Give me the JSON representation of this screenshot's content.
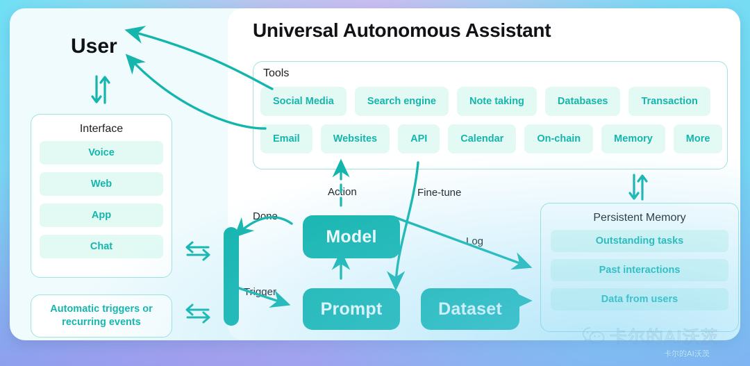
{
  "background": {
    "gradient_from": "#6fe0f5",
    "gradient_mid": "#c9bdf0",
    "gradient_to": "#6fdff5"
  },
  "theme": {
    "accent": "#14b5ad",
    "pill_bg": "#e3faf4",
    "card_bg": "#f0fbfd",
    "panel_bg": "#ffffff",
    "border": "#9fe3de",
    "text_dark": "#111215"
  },
  "left": {
    "user_title": "User",
    "user_exchange_icon": "bidirectional-vertical-arrow-icon",
    "interface": {
      "title": "Interface",
      "items": [
        {
          "label": "Voice"
        },
        {
          "label": "Web"
        },
        {
          "label": "App"
        },
        {
          "label": "Chat"
        }
      ]
    },
    "triggers": {
      "line1": "Automatic triggers or",
      "line2": "recurring events"
    },
    "exchange_icons": [
      "exchange-arrows-icon",
      "exchange-arrows-icon"
    ]
  },
  "assistant": {
    "title": "Universal Autonomous Assistant",
    "tools": {
      "label": "Tools",
      "row1": [
        {
          "label": "Social Media"
        },
        {
          "label": "Search engine"
        },
        {
          "label": "Note taking"
        },
        {
          "label": "Databases"
        },
        {
          "label": "Transaction"
        }
      ],
      "row2": [
        {
          "label": "Email"
        },
        {
          "label": "Websites"
        },
        {
          "label": "API"
        },
        {
          "label": "Calendar"
        },
        {
          "label": "On-chain"
        },
        {
          "label": "Memory"
        },
        {
          "label": "More"
        }
      ]
    },
    "flow": {
      "nodes": [
        {
          "id": "model",
          "label": "Model"
        },
        {
          "id": "prompt",
          "label": "Prompt"
        },
        {
          "id": "dataset",
          "label": "Dataset"
        }
      ],
      "labels": {
        "action": "Action",
        "done": "Done",
        "trigger": "Trigger",
        "fine_tune": "Fine-tune",
        "log": "Log"
      }
    },
    "memory": {
      "title": "Persistent Memory",
      "exchange_icon": "bidirectional-vertical-arrow-icon",
      "items": [
        {
          "label": "Outstanding tasks"
        },
        {
          "label": "Past interactions"
        },
        {
          "label": "Data from users"
        }
      ]
    }
  },
  "watermark": {
    "big_text": "卡尔的AI沃茨",
    "small_text": "卡尔的AI沃茨",
    "icon": "wechat-icon"
  }
}
